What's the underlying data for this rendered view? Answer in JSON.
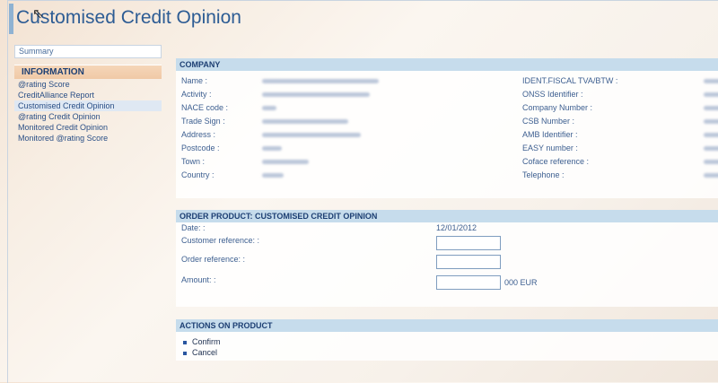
{
  "page": {
    "title": "Customised Credit Opinion"
  },
  "sidebar": {
    "summary": "Summary",
    "section_title": "INFORMATION",
    "items": [
      {
        "label": "@rating Score"
      },
      {
        "label": "CreditAlliance Report"
      },
      {
        "label": "Customised Credit Opinion"
      },
      {
        "label": "@rating Credit Opinion"
      },
      {
        "label": "Monitored Credit Opinion"
      },
      {
        "label": "Monitored @rating Score"
      }
    ]
  },
  "company": {
    "heading": "COMPANY",
    "left_fields": [
      {
        "label": "Name :"
      },
      {
        "label": "Activity :"
      },
      {
        "label": "NACE code :"
      },
      {
        "label": "Trade Sign :"
      },
      {
        "label": "Address :"
      },
      {
        "label": "Postcode :"
      },
      {
        "label": "Town :"
      },
      {
        "label": "Country :"
      }
    ],
    "right_fields": [
      {
        "label": "IDENT.FISCAL TVA/BTW :"
      },
      {
        "label": "ONSS Identifier :"
      },
      {
        "label": "Company Number :"
      },
      {
        "label": "CSB Number :"
      },
      {
        "label": "AMB Identifier :"
      },
      {
        "label": "EASY number :"
      },
      {
        "label": "Coface reference :"
      },
      {
        "label": "Telephone :"
      }
    ]
  },
  "order": {
    "heading": "ORDER PRODUCT: CUSTOMISED CREDIT OPINION",
    "date_label": "Date: :",
    "date_value": "12/01/2012",
    "customer_ref_label": "Customer reference: :",
    "customer_ref_value": "",
    "order_ref_label": "Order reference: :",
    "order_ref_value": "",
    "amount_label": "Amount: :",
    "amount_value": "",
    "amount_suffix": "000 EUR"
  },
  "actions": {
    "heading": "ACTIONS ON PRODUCT",
    "confirm": "Confirm",
    "cancel": "Cancel"
  },
  "colors": {
    "accent": "#2d5c94",
    "panel_header": "#c6dcec",
    "sidebar_header": "#f0c9a6"
  }
}
